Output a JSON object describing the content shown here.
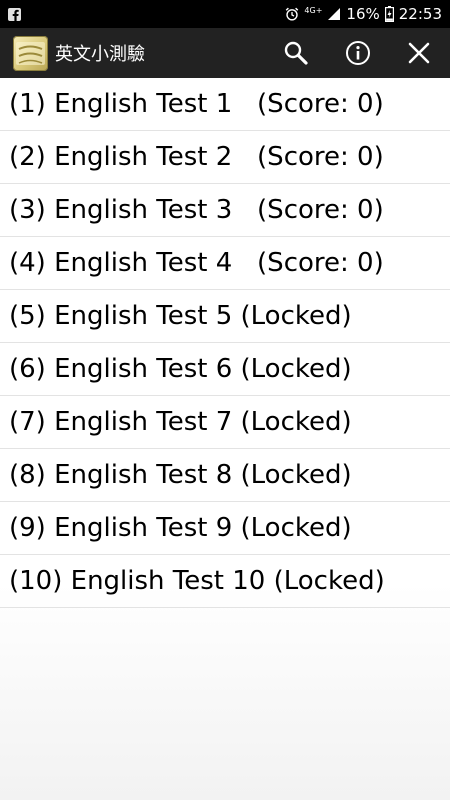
{
  "status_bar": {
    "network_label": "4G+",
    "battery": "16%",
    "time": "22:53"
  },
  "app_bar": {
    "title": "英文小測驗",
    "icons": [
      "app-logo",
      "search-icon",
      "info-icon",
      "close-icon"
    ]
  },
  "tests": [
    {
      "label": "(1) English Test 1   (Score: 0)"
    },
    {
      "label": "(2) English Test 2   (Score: 0)"
    },
    {
      "label": "(3) English Test 3   (Score: 0)"
    },
    {
      "label": "(4) English Test 4   (Score: 0)"
    },
    {
      "label": "(5) English Test 5 (Locked)"
    },
    {
      "label": "(6) English Test 6 (Locked)"
    },
    {
      "label": "(7) English Test 7 (Locked)"
    },
    {
      "label": "(8) English Test 8 (Locked)"
    },
    {
      "label": "(9) English Test 9 (Locked)"
    },
    {
      "label": "(10) English Test 10 (Locked)"
    }
  ]
}
